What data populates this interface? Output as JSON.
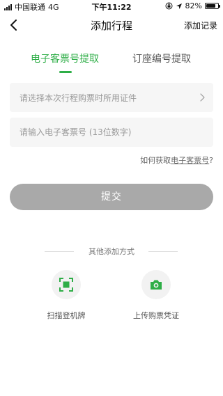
{
  "status_bar": {
    "carrier": "中国联通",
    "network": "4G",
    "time": "下午11:22",
    "battery_percent": "82%",
    "battery_level": 0.82
  },
  "nav": {
    "title": "添加行程",
    "right_action": "添加记录"
  },
  "tabs": [
    {
      "label": "电子客票号提取",
      "active": true
    },
    {
      "label": "订座编号提取",
      "active": false
    }
  ],
  "form": {
    "id_select_placeholder": "请选择本次行程购票时所用证件",
    "ticket_input_placeholder": "请输入电子客票号 (13位数字)",
    "help_prefix": "如何获取",
    "help_link": "电子客票号",
    "help_suffix": "?",
    "submit_label": "提交"
  },
  "other_methods": {
    "title": "其他添加方式",
    "options": [
      {
        "label": "扫描登机牌",
        "icon": "scan-icon"
      },
      {
        "label": "上传购票凭证",
        "icon": "camera-icon"
      }
    ]
  },
  "colors": {
    "accent": "#2eae47",
    "button_disabled": "#a9a9a9",
    "field_background": "#f6f6f6"
  }
}
